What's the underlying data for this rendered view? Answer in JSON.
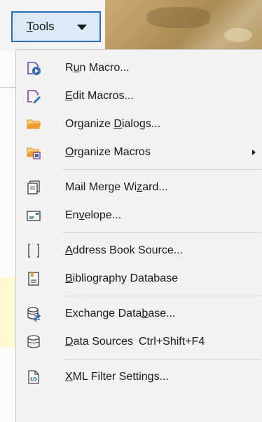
{
  "toolbar": {
    "tools_label_accel": "T",
    "tools_label_rest": "ools"
  },
  "menu": {
    "items": [
      {
        "pre": "R",
        "accel": "u",
        "post": "n Macro...",
        "icon": "run-macro-icon"
      },
      {
        "pre": "",
        "accel": "E",
        "post": "dit Macros...",
        "icon": "edit-macros-icon"
      },
      {
        "pre": "Organize ",
        "accel": "D",
        "post": "ialogs...",
        "icon": "folder-icon"
      },
      {
        "pre": "",
        "accel": "O",
        "post": "rganize Macros",
        "icon": "organize-macros-icon",
        "submenu": true
      },
      {
        "pre": "Mail Merge Wi",
        "accel": "z",
        "post": "ard...",
        "icon": "mail-merge-icon"
      },
      {
        "pre": "En",
        "accel": "v",
        "post": "elope...",
        "icon": "envelope-icon"
      },
      {
        "pre": "",
        "accel": "A",
        "post": "ddress Book Source...",
        "icon": "address-book-icon"
      },
      {
        "pre": "",
        "accel": "B",
        "post": "ibliography Database",
        "icon": "bibliography-icon"
      },
      {
        "pre": "Exchange Data",
        "accel": "b",
        "post": "ase...",
        "icon": "exchange-database-icon"
      },
      {
        "pre": "",
        "accel": "D",
        "post": "ata Sources",
        "icon": "data-sources-icon",
        "shortcut": "Ctrl+Shift+F4"
      },
      {
        "pre": "",
        "accel": "X",
        "post": "ML Filter Settings...",
        "icon": "xml-filter-icon"
      }
    ]
  },
  "colors": {
    "accent": "#2c6fb6",
    "menu_bg": "#f2f2f2",
    "icon_purple": "#7b3f9e",
    "icon_blue": "#2f6fb6",
    "icon_orange": "#f0a030"
  }
}
